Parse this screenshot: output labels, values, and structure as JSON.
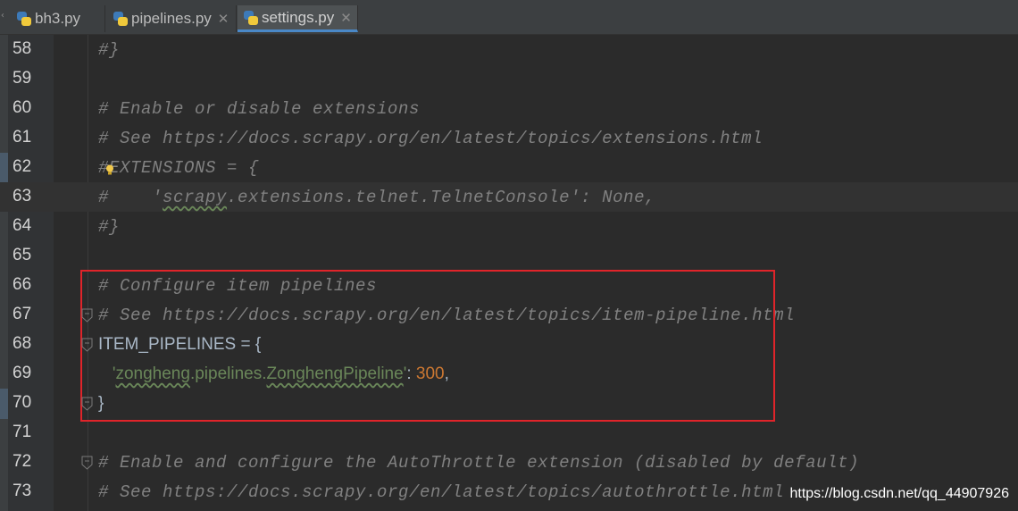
{
  "tabs": [
    {
      "label": "bh3.py",
      "icon": "python-file-icon",
      "active": false
    },
    {
      "label": "pipelines.py",
      "icon": "python-file-icon",
      "active": false
    },
    {
      "label": "settings.py",
      "icon": "python-file-icon",
      "active": true
    }
  ],
  "lines": [
    {
      "num": "58",
      "parts": [
        {
          "t": "#}",
          "c": "cm"
        }
      ]
    },
    {
      "num": "59",
      "parts": []
    },
    {
      "num": "60",
      "parts": [
        {
          "t": "# Enable or disable extensions",
          "c": "cm"
        }
      ]
    },
    {
      "num": "61",
      "parts": [
        {
          "t": "# See https://docs.scrapy.org/en/latest/topics/extensions.html",
          "c": "cm"
        }
      ]
    },
    {
      "num": "62",
      "parts": [
        {
          "t": "#EXTENSIONS = {",
          "c": "cm"
        }
      ]
    },
    {
      "num": "63",
      "parts": [
        {
          "t": "#    '",
          "c": "cm"
        },
        {
          "t": "scrapy",
          "c": "cm wavy"
        },
        {
          "t": ".extensions.telnet.TelnetConsole': None,",
          "c": "cm"
        }
      ]
    },
    {
      "num": "64",
      "parts": [
        {
          "t": "#}",
          "c": "cm"
        }
      ]
    },
    {
      "num": "65",
      "parts": []
    },
    {
      "num": "66",
      "parts": [
        {
          "t": "# Configure item pipelines",
          "c": "cm"
        }
      ]
    },
    {
      "num": "67",
      "parts": [
        {
          "t": "# See https://docs.scrapy.org/en/latest/topics/item-pipeline.html",
          "c": "cm"
        }
      ]
    },
    {
      "num": "68",
      "parts": [
        {
          "t": "ITEM_PIPELINES = {",
          "c": "plain"
        }
      ]
    },
    {
      "num": "69",
      "parts": [
        {
          "t": "   '",
          "c": "str"
        },
        {
          "t": "zongheng",
          "c": "str wavy"
        },
        {
          "t": ".pipelines.",
          "c": "str"
        },
        {
          "t": "ZonghengPipeline",
          "c": "str wavy"
        },
        {
          "t": "'",
          "c": "str"
        },
        {
          "t": ": ",
          "c": "plain"
        },
        {
          "t": "300",
          "c": "num2"
        },
        {
          "t": ",",
          "c": "plain"
        }
      ]
    },
    {
      "num": "70",
      "parts": [
        {
          "t": "}",
          "c": "plain"
        }
      ]
    },
    {
      "num": "71",
      "parts": []
    },
    {
      "num": "72",
      "parts": [
        {
          "t": "# Enable and configure the AutoThrottle extension (disabled by default)",
          "c": "cm"
        }
      ]
    },
    {
      "num": "73",
      "parts": [
        {
          "t": "# See https://docs.scrapy.org/en/latest/topics/autothrottle.html",
          "c": "cm"
        }
      ]
    }
  ],
  "current_line": "63",
  "watermark": "https://blog.csdn.net/qq_44907926",
  "colors": {
    "comment": "#808080",
    "string": "#6a8759",
    "number": "#cc7832",
    "text": "#a9b7c6",
    "highlight_box": "#e0242a",
    "background": "#2b2b2b"
  }
}
